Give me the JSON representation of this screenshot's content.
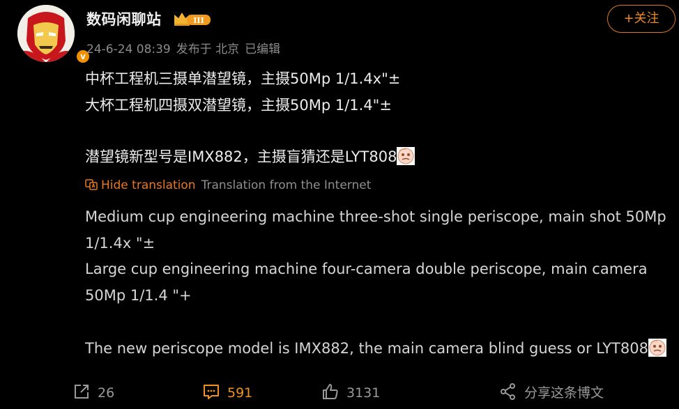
{
  "header": {
    "username": "数码闲聊站",
    "level_badge": "III",
    "date": "24-6-24 08:39",
    "location": "发布于 北京",
    "edited": "已编辑",
    "follow_label": "+关注",
    "verified_badge": "v"
  },
  "post": {
    "original_lines": [
      "中杯工程机三摄单潜望镜，主摄50Mp 1/1.4x\"±",
      "大杯工程机四摄双潜望镜，主摄50Mp 1/1.4\"±",
      "潜望镜新型号是IMX882，主摄盲猜还是LYT808"
    ],
    "translation": {
      "hide_label": "Hide translation",
      "source_label": "Translation from the Internet",
      "lines": [
        "Medium cup engineering machine three-shot single periscope, main shot 50Mp",
        "1/1.4x \"±",
        "Large cup engineering machine four-camera double periscope, main camera",
        "50Mp 1/1.4 \"+",
        "The new periscope model is IMX882, the main camera blind guess or LYT808"
      ]
    }
  },
  "actions": {
    "repost_count": "26",
    "comment_count": "591",
    "like_count": "3131",
    "share_label": "分享这条博文"
  },
  "colors": {
    "background": "#000000",
    "accent_orange": "#f0931f",
    "meta_gray": "#8c8c8c"
  }
}
